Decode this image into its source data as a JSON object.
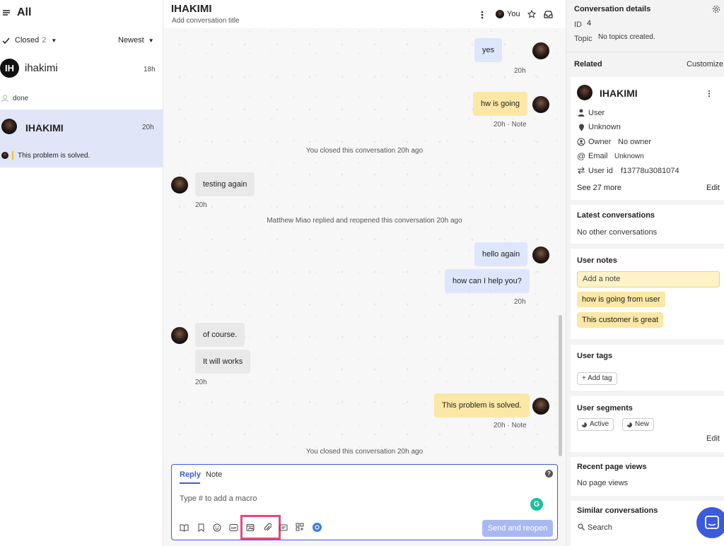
{
  "left": {
    "title": "All",
    "filter_status": "Closed",
    "filter_count": "2",
    "sort": "Newest",
    "conversations": [
      {
        "avatar": "IH",
        "name": "ihakimi",
        "time": "18h",
        "preview": "done"
      },
      {
        "name": "IHAKIMI",
        "time": "20h",
        "preview": "This problem is solved."
      }
    ]
  },
  "header": {
    "title": "IHAKIMI",
    "subtitle": "Add conversation title",
    "assignee": "You"
  },
  "messages": [
    {
      "text": "yes",
      "time": "20h"
    },
    {
      "text": "hw is going",
      "time": "20h · Note"
    },
    {
      "text": "You closed this conversation 20h ago"
    },
    {
      "text": "testing again",
      "time": "20h"
    },
    {
      "text": "Matthew Miao replied and reopened this conversation 20h ago"
    },
    {
      "text": "hello again"
    },
    {
      "text": "how can I help you?",
      "time": "20h"
    },
    {
      "text": "of course."
    },
    {
      "text": "It will works",
      "time": "20h"
    },
    {
      "text": "This problem is solved.",
      "time": "20h · Note"
    },
    {
      "text": "You closed this conversation 20h ago"
    }
  ],
  "composer": {
    "tab_reply": "Reply",
    "tab_note": "Note",
    "placeholder": "Type # to add a macro",
    "send_label": "Send and reopen",
    "help": "?"
  },
  "details": {
    "title": "Conversation details",
    "id_label": "ID",
    "id_value": "4",
    "topic_label": "Topic",
    "topic_value": "No topics created.",
    "related": "Related",
    "customize": "Customize"
  },
  "user_card": {
    "name": "IHAKIMI",
    "type": "User",
    "location": "Unknown",
    "owner_label": "Owner",
    "owner_value": "No owner",
    "email_label": "Email",
    "email_value": "Unknown",
    "userid_label": "User id",
    "userid_value": "f13778u3081074",
    "see_more": "See 27 more",
    "edit": "Edit"
  },
  "latest": {
    "title": "Latest conversations",
    "empty": "No other conversations"
  },
  "notes": {
    "title": "User notes",
    "placeholder": "Add a note",
    "items": [
      "how is going from user",
      "This customer is great"
    ]
  },
  "tags": {
    "title": "User tags",
    "add": "+ Add tag"
  },
  "segments": {
    "title": "User segments",
    "items": [
      "Active",
      "New"
    ],
    "edit": "Edit"
  },
  "page_views": {
    "title": "Recent page views",
    "empty": "No page views"
  },
  "similar": {
    "title": "Similar conversations",
    "search": "Search"
  },
  "colors": {
    "accent": "#3b5bdb",
    "highlight": "#e8487a",
    "note": "#fbe8a6",
    "user_bubble": "#dde6fb",
    "grammarly": "#15c39a"
  }
}
